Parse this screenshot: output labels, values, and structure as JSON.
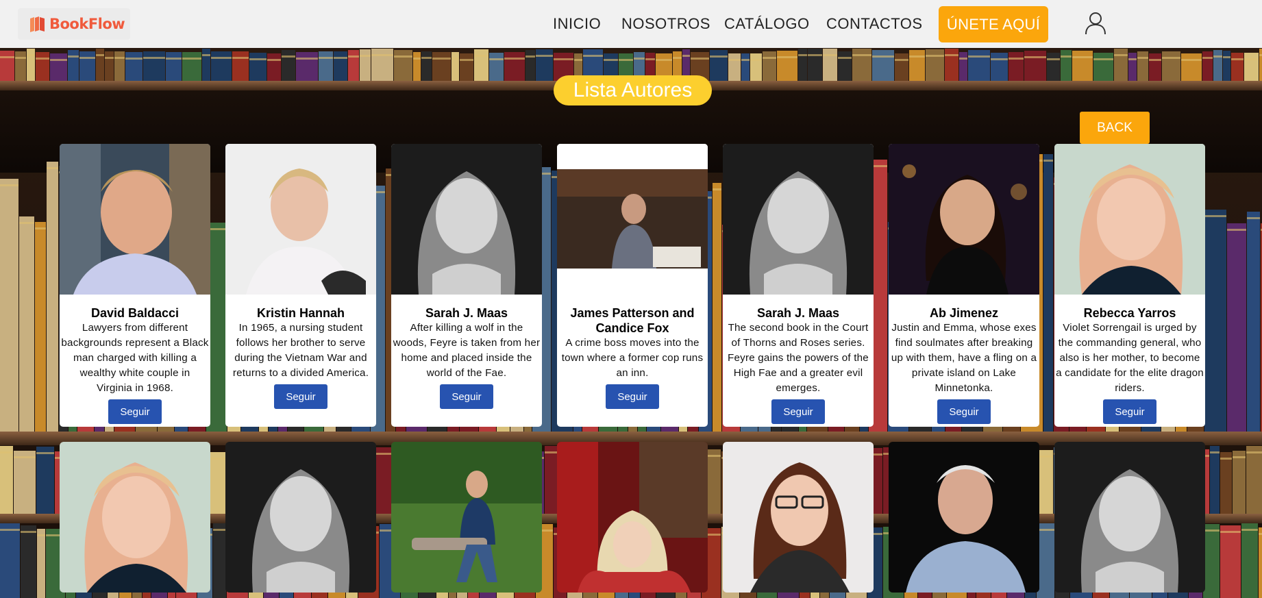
{
  "brand": {
    "name": "BookFlow",
    "icon": "book-logo-icon",
    "color": "#f05a3c"
  },
  "nav": {
    "links": [
      "INICIO",
      "NOSOTROS",
      "CATÁLOGO",
      "CONTACTOS"
    ],
    "join_label": "ÚNETE AQUÍ",
    "user_icon": "user-icon"
  },
  "colors": {
    "accent": "#fba60c",
    "title_pill": "#fccf2e",
    "follow": "#2753b0"
  },
  "page_title": "Lista Autores",
  "back_label": "BACK",
  "follow_label": "Seguir",
  "authors": [
    {
      "name": "David Baldacci",
      "description": "Lawyers from different backgrounds represent a Black man charged with killing a wealthy white couple in Virginia in 1968."
    },
    {
      "name": "Kristin Hannah",
      "description": "In 1965, a nursing student follows her brother to serve during the Vietnam War and returns to a divided America."
    },
    {
      "name": "Sarah J. Maas",
      "description": "After killing a wolf in the woods, Feyre is taken from her home and placed inside the world of the Fae."
    },
    {
      "name": "James Patterson and Candice Fox",
      "description": "A crime boss moves into the town where a former cop runs an inn."
    },
    {
      "name": "Sarah J. Maas",
      "description": "The second book in the Court of Thorns and Roses series. Feyre gains the powers of the High Fae and a greater evil emerges."
    },
    {
      "name": "Ab Jimenez",
      "description": "Justin and Emma, whose exes find soulmates after breaking up with them, have a fling on a private island on Lake Minnetonka."
    },
    {
      "name": "Rebecca Yarros",
      "description": "Violet Sorrengail is urged by the commanding general, who also is her mother, to become a candidate for the elite dragon riders."
    }
  ]
}
